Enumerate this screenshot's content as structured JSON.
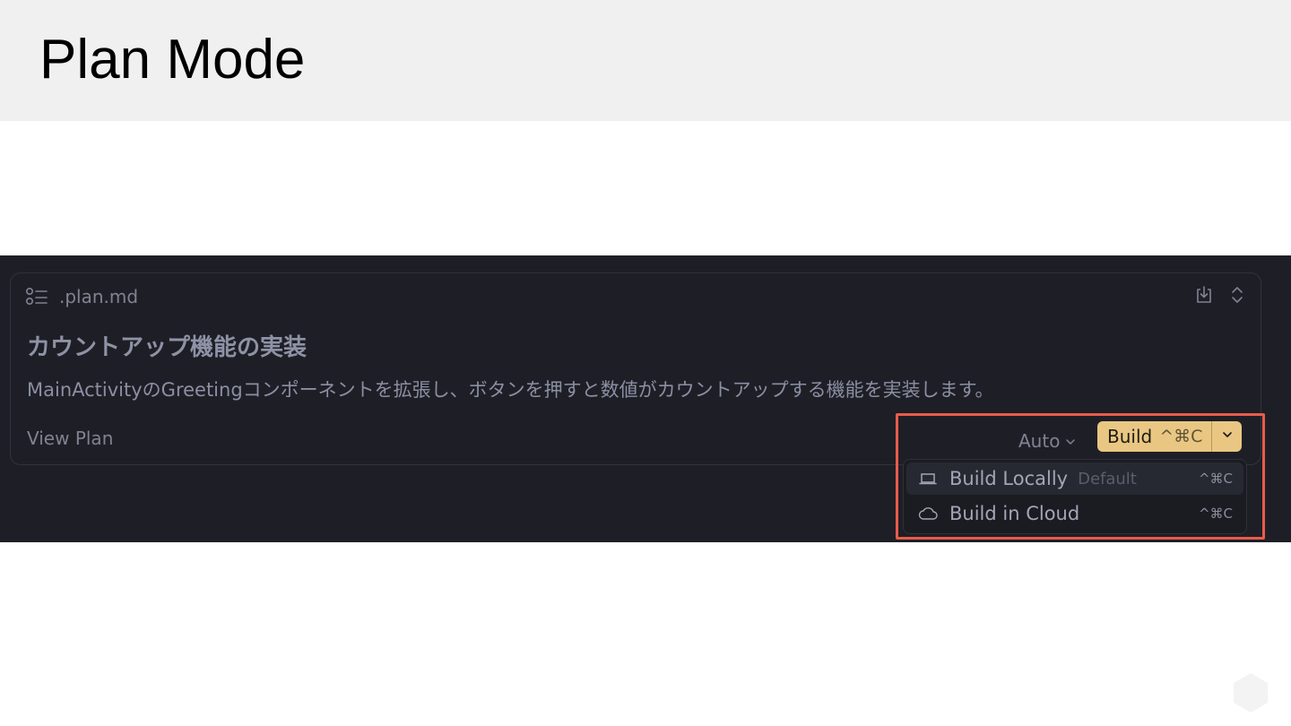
{
  "slide": {
    "title": "Plan Mode"
  },
  "plan_card": {
    "file_name": ".plan.md",
    "file_icon": "list-icon",
    "title": "カウントアップ機能の実装",
    "description": "MainActivityのGreetingコンポーネントを拡張し、ボタンを押すと数値がカウントアップする機能を実装します。",
    "view_plan_label": "View Plan",
    "actions": [
      {
        "icon": "download-icon"
      },
      {
        "icon": "expand-collapse-icon"
      }
    ]
  },
  "toolbar": {
    "mode_label": "Auto",
    "build_label": "Build",
    "build_shortcut": "^⌘C"
  },
  "build_menu": {
    "items": [
      {
        "icon": "laptop-icon",
        "label": "Build Locally",
        "tag": "Default",
        "shortcut": "^⌘C",
        "active": true
      },
      {
        "icon": "cloud-icon",
        "label": "Build in Cloud",
        "shortcut": "^⌘C",
        "active": false
      }
    ]
  },
  "colors": {
    "panel_bg": "#1e1f26",
    "build_accent": "#e9c783",
    "highlight": "#ea5b4c",
    "header_bg": "#f0f0f0"
  }
}
